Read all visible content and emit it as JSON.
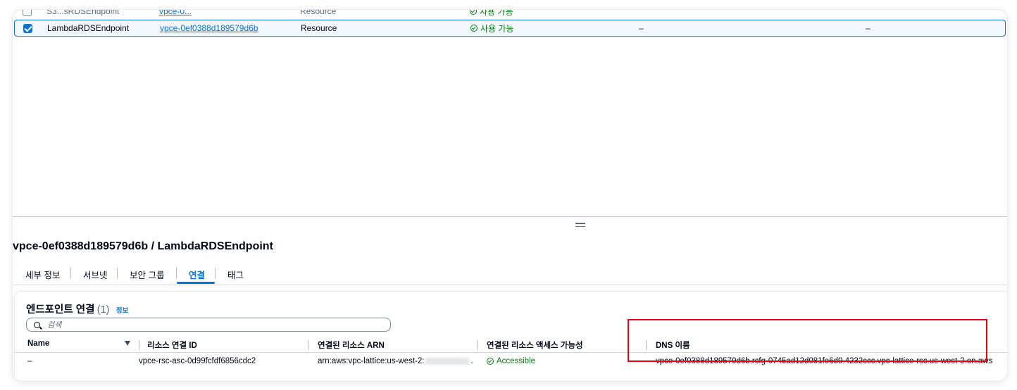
{
  "top_table": {
    "partial_row": {
      "name": "S3...sRDSEndpoint",
      "endpoint_id": "vpce-0... ",
      "type": "Resource",
      "status": "사용 가능"
    },
    "selected_row": {
      "name": "LambdaRDSEndpoint",
      "endpoint_id": "vpce-0ef0388d189579d6b",
      "type": "Resource",
      "status": "사용 가능",
      "col5": "–",
      "col6": "–"
    }
  },
  "details": {
    "title": "vpce-0ef0388d189579d6b / LambdaRDSEndpoint",
    "tabs": [
      "세부 정보",
      "서브넷",
      "보안 그룹",
      "연결",
      "태그"
    ],
    "active_tab": "연결"
  },
  "connections": {
    "title": "엔드포인트 연결",
    "count": "(1)",
    "info_label": "정보",
    "search_placeholder": "검색",
    "columns": [
      "Name",
      "리소스 연결 ID",
      "연결된 리소스 ARN",
      "연결된 리소스 액세스 가능성",
      "DNS 이름"
    ],
    "rows": [
      {
        "name": "–",
        "association_id": "vpce-rsc-asc-0d99fcfdf6856cdc2",
        "arn_prefix": "arn:aws:vpc-lattice:us-west-2:",
        "arn_suffix": ".",
        "accessibility": "Accessible",
        "dns_name": "vpce-0ef0388d189579d6b.rcfg-0745ad12d081fe6d9.4232ccc.vpc-lattice-rsc.us-west-2.on.aws"
      }
    ]
  },
  "colors": {
    "accent": "#0972d3",
    "success": "#037f0c",
    "highlight": "#e3000f"
  },
  "icons": [
    "checkbox-checked-icon",
    "status-available-icon",
    "search-icon",
    "sort-icon",
    "split-handle-icon"
  ]
}
